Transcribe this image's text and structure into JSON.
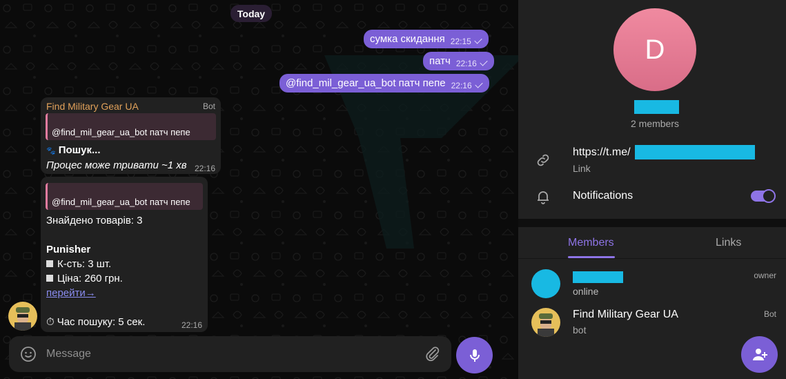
{
  "chat": {
    "date_label": "Today",
    "outgoing": [
      {
        "text": "сумка скидання",
        "time": "22:15"
      },
      {
        "text": "патч",
        "time": "22:16"
      },
      {
        "text": "@find_mil_gear_ua_bot патч пепе",
        "time": "22:16"
      }
    ],
    "bot_msg_1": {
      "sender": "Find Military Gear UA",
      "badge": "Bot",
      "reply": "@find_mil_gear_ua_bot патч пепе",
      "line1": "Пошук...",
      "line2": "Процес може тривати ~1 хв",
      "time": "22:16"
    },
    "bot_msg_2": {
      "reply": "@find_mil_gear_ua_bot патч пепе",
      "found": "Знайдено товарів: 3",
      "product": "Punisher",
      "qty": "К-сть: 3 шт.",
      "price": "Ціна: 260 грн.",
      "link": "перейти→",
      "duration": "Час пошуку: 5 сек.",
      "time": "22:16"
    },
    "composer_placeholder": "Message"
  },
  "panel": {
    "avatar_letter": "D",
    "members_count": "2 members",
    "link_prefix": "https://t.me/",
    "link_label": "Link",
    "notifications_label": "Notifications",
    "notifications_on": true,
    "tabs": [
      "Members",
      "Links"
    ],
    "members": [
      {
        "status": "online",
        "role": "owner"
      },
      {
        "name": "Find Military Gear UA",
        "status": "bot",
        "role": "Bot"
      }
    ]
  },
  "colors": {
    "accent": "#7b5fd6",
    "bot_name": "#e1a15a",
    "redaction": "#18b9e3"
  }
}
